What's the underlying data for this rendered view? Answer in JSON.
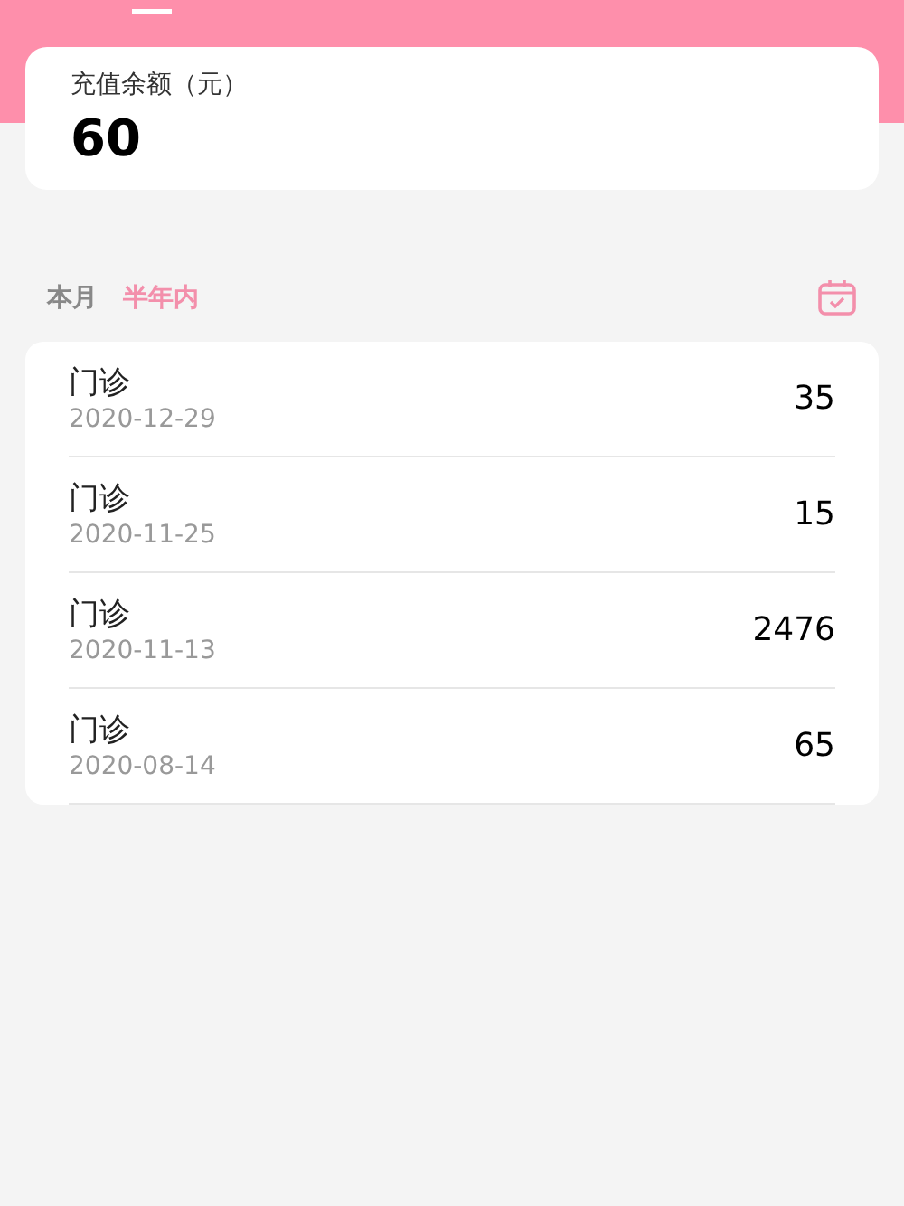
{
  "balance": {
    "label": "充值余额（元）",
    "amount": "60"
  },
  "tabs": [
    {
      "label": "本月",
      "selected": false
    },
    {
      "label": "半年内",
      "selected": true
    }
  ],
  "records": [
    {
      "title": "门诊",
      "date": "2020-12-29",
      "amount": "35"
    },
    {
      "title": "门诊",
      "date": "2020-11-25",
      "amount": "15"
    },
    {
      "title": "门诊",
      "date": "2020-11-13",
      "amount": "2476"
    },
    {
      "title": "门诊",
      "date": "2020-08-14",
      "amount": "65"
    }
  ]
}
